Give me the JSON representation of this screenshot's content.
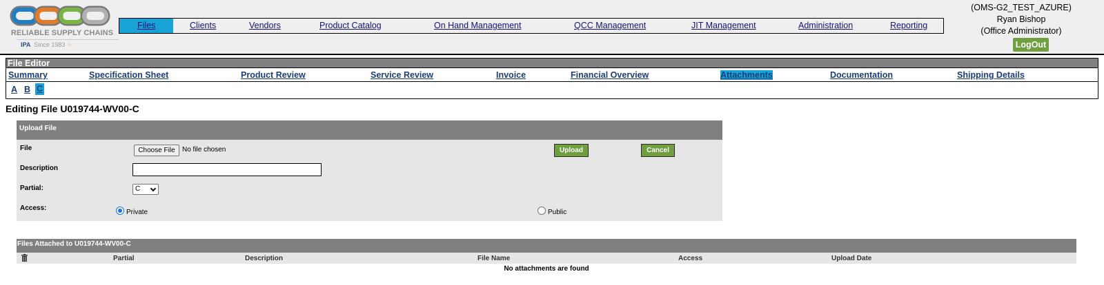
{
  "logo": {
    "name": "RELIABLE SUPPLY CHAINS",
    "tagline": "Since 1983",
    "partner": "IPA"
  },
  "nav": {
    "items": [
      "Files",
      "Clients",
      "Vendors",
      "Product Catalog",
      "On Hand Management",
      "QCC Management",
      "JIT Management",
      "Administration",
      "Reporting"
    ],
    "active": "Files"
  },
  "user": {
    "environment": "(OMS-G2_TEST_AZURE)",
    "name": "Ryan Bishop",
    "role": "(Office Administrator)",
    "logout_label": "LogOut"
  },
  "editor": {
    "title": "File Editor",
    "tabs": [
      "Summary",
      "Specification Sheet",
      "Product Review",
      "Service Review",
      "Invoice",
      "Financial Overview",
      "Attachments",
      "Documentation",
      "Shipping Details"
    ],
    "active_tab": "Attachments",
    "partials": [
      "A",
      "B",
      "C"
    ],
    "active_partial": "C"
  },
  "page_title": "Editing File U019744-WV00-C",
  "upload": {
    "heading": "Upload File",
    "file_label": "File",
    "choose_label": "Choose File",
    "no_file_text": "No file chosen",
    "upload_label": "Upload",
    "cancel_label": "Cancel",
    "description_label": "Description",
    "description_value": "",
    "partial_label": "Partial:",
    "partial_value": "C",
    "access_label": "Access:",
    "access_options": [
      "Private",
      "Public"
    ],
    "access_selected": "Private"
  },
  "attachments": {
    "heading": "Files Attached to U019744-WV00-C",
    "columns": [
      "Partial",
      "Description",
      "File Name",
      "Access",
      "Upload Date"
    ],
    "empty_text": "No attachments are found"
  },
  "colors": {
    "accent_blue": "#17a3d6",
    "button_green": "#6f9f3f",
    "header_gray": "#808080"
  }
}
